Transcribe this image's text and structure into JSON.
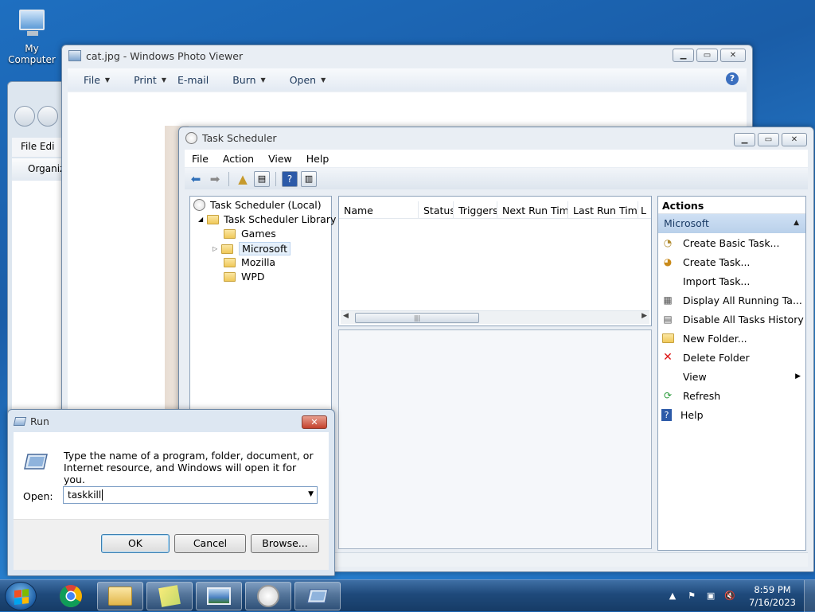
{
  "desktop": {
    "icons": [
      {
        "label": "My Computer",
        "icon": "computer-icon"
      }
    ]
  },
  "explorer": {
    "menu": "File   Edi",
    "organize": "Organize"
  },
  "photo_viewer": {
    "title": "cat.jpg - Windows Photo Viewer",
    "toolbar": {
      "file": "File",
      "print": "Print",
      "email": "E-mail",
      "burn": "Burn",
      "open": "Open"
    },
    "help_glyph": "?"
  },
  "task_scheduler": {
    "title": "Task Scheduler",
    "menu": {
      "file": "File",
      "action": "Action",
      "view": "View",
      "help": "Help"
    },
    "tree": {
      "root": "Task Scheduler (Local)",
      "library": "Task Scheduler Library",
      "folders": [
        "Games",
        "Microsoft",
        "Mozilla",
        "WPD"
      ],
      "selected": "Microsoft"
    },
    "columns": [
      "Name",
      "Status",
      "Triggers",
      "Next Run Time",
      "Last Run Time",
      "L"
    ],
    "actions": {
      "header": "Actions",
      "group": "Microsoft",
      "items": [
        {
          "label": "Create Basic Task...",
          "icon": "create-basic-task-icon"
        },
        {
          "label": "Create Task...",
          "icon": "create-task-icon"
        },
        {
          "label": "Import Task...",
          "icon": ""
        },
        {
          "label": "Display All Running Ta...",
          "icon": "running-tasks-icon"
        },
        {
          "label": "Disable All Tasks History",
          "icon": "history-icon"
        },
        {
          "label": "New Folder...",
          "icon": "new-folder-icon"
        },
        {
          "label": "Delete Folder",
          "icon": "delete-icon"
        },
        {
          "label": "View",
          "icon": ""
        },
        {
          "label": "Refresh",
          "icon": "refresh-icon"
        },
        {
          "label": "Help",
          "icon": "help-icon"
        }
      ]
    }
  },
  "run_dialog": {
    "title": "Run",
    "prompt": "Type the name of a program, folder, document, or Internet resource, and Windows will open it for you.",
    "open_label": "Open:",
    "input_value": "taskkill",
    "buttons": {
      "ok": "OK",
      "cancel": "Cancel",
      "browse": "Browse..."
    }
  },
  "taskbar": {
    "time": "8:59 PM",
    "date": "7/16/2023",
    "pinned": [
      "chrome-icon",
      "file-explorer-icon",
      "sticky-notes-icon",
      "photo-viewer-icon",
      "task-scheduler-icon",
      "run-icon"
    ]
  },
  "colors": {
    "accent": "#3c7fb1",
    "close_red": "#c4412c",
    "taskbar": "#1f4a7b"
  }
}
